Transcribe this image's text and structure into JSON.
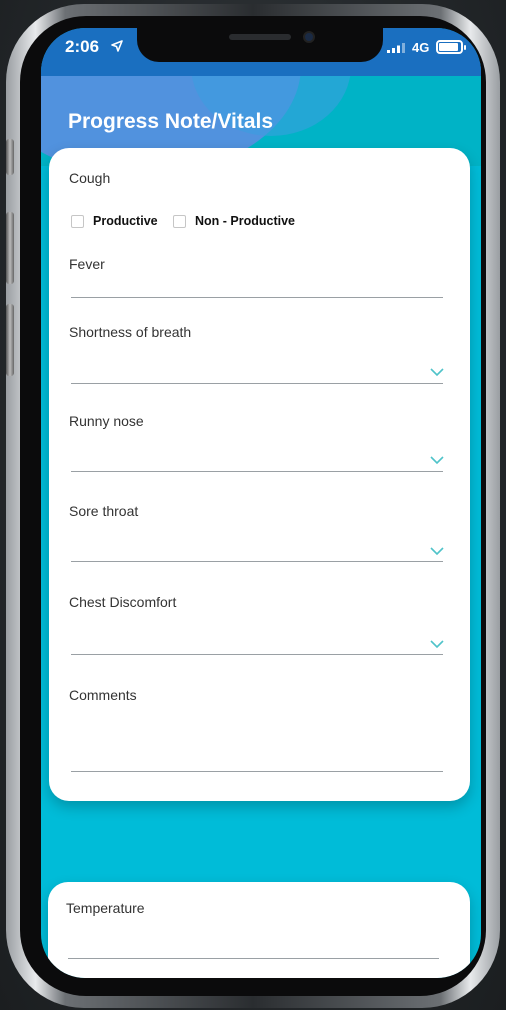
{
  "status_bar": {
    "time": "2:06",
    "network": "4G"
  },
  "header": {
    "title": "Progress Note/Vitals"
  },
  "cough": {
    "label": "Cough",
    "options": [
      {
        "label": "Productive",
        "checked": false
      },
      {
        "label": "Non - Productive",
        "checked": false
      }
    ]
  },
  "fields": {
    "fever": {
      "label": "Fever",
      "value": ""
    },
    "shortness_of_breath": {
      "label": "Shortness of breath",
      "value": ""
    },
    "runny_nose": {
      "label": "Runny nose",
      "value": ""
    },
    "sore_throat": {
      "label": "Sore throat",
      "value": ""
    },
    "chest_discomfort": {
      "label": "Chest Discomfort",
      "value": ""
    },
    "comments": {
      "label": "Comments",
      "value": ""
    }
  },
  "vitals": {
    "temperature": {
      "label": "Temperature",
      "value": ""
    }
  },
  "icons": {
    "location": "location-arrow-icon",
    "signal": "signal-bars-icon",
    "battery": "battery-icon",
    "dropdown": "chevron-down-icon"
  },
  "colors": {
    "accent": "#4fc3c9",
    "status_bar": "#1a6fc0",
    "background": "#00bcd8"
  }
}
